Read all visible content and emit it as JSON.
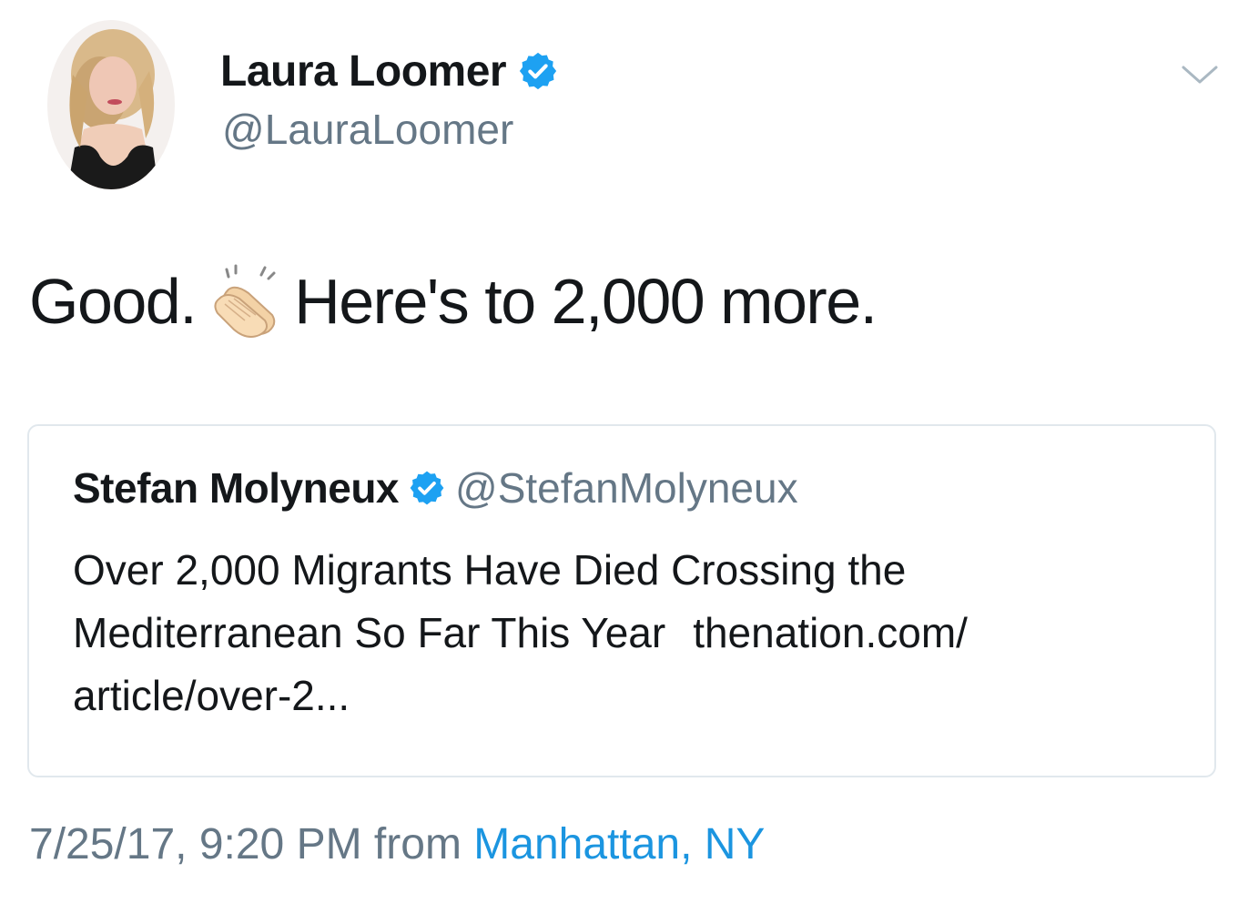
{
  "author": {
    "display_name": "Laura Loomer",
    "handle": "@LauraLoomer",
    "verified_icon": "verified-badge-icon",
    "avatar": "profile-photo"
  },
  "tweet": {
    "text_before": "Good.",
    "emoji": "clapping-hands-emoji",
    "text_after": "Here's to 2,000 more."
  },
  "quoted_tweet": {
    "display_name": "Stefan Molyneux",
    "handle": "@StefanMolyneux",
    "verified_icon": "verified-badge-icon",
    "line1": "Over 2,000 Migrants Have Died Crossing the",
    "line2_text": "Mediterranean So Far This Year",
    "line2_link": "thenation.com/",
    "line3": "article/over-2..."
  },
  "meta": {
    "timestamp": "7/25/17, 9:20 PM",
    "from_label": "from",
    "location": "Manhattan, NY"
  },
  "colors": {
    "verified_blue": "#1da1f2",
    "link_blue": "#1b95e0",
    "secondary_gray": "#657786",
    "border": "#e1e8ed"
  },
  "menu_icon": "chevron-down-icon"
}
